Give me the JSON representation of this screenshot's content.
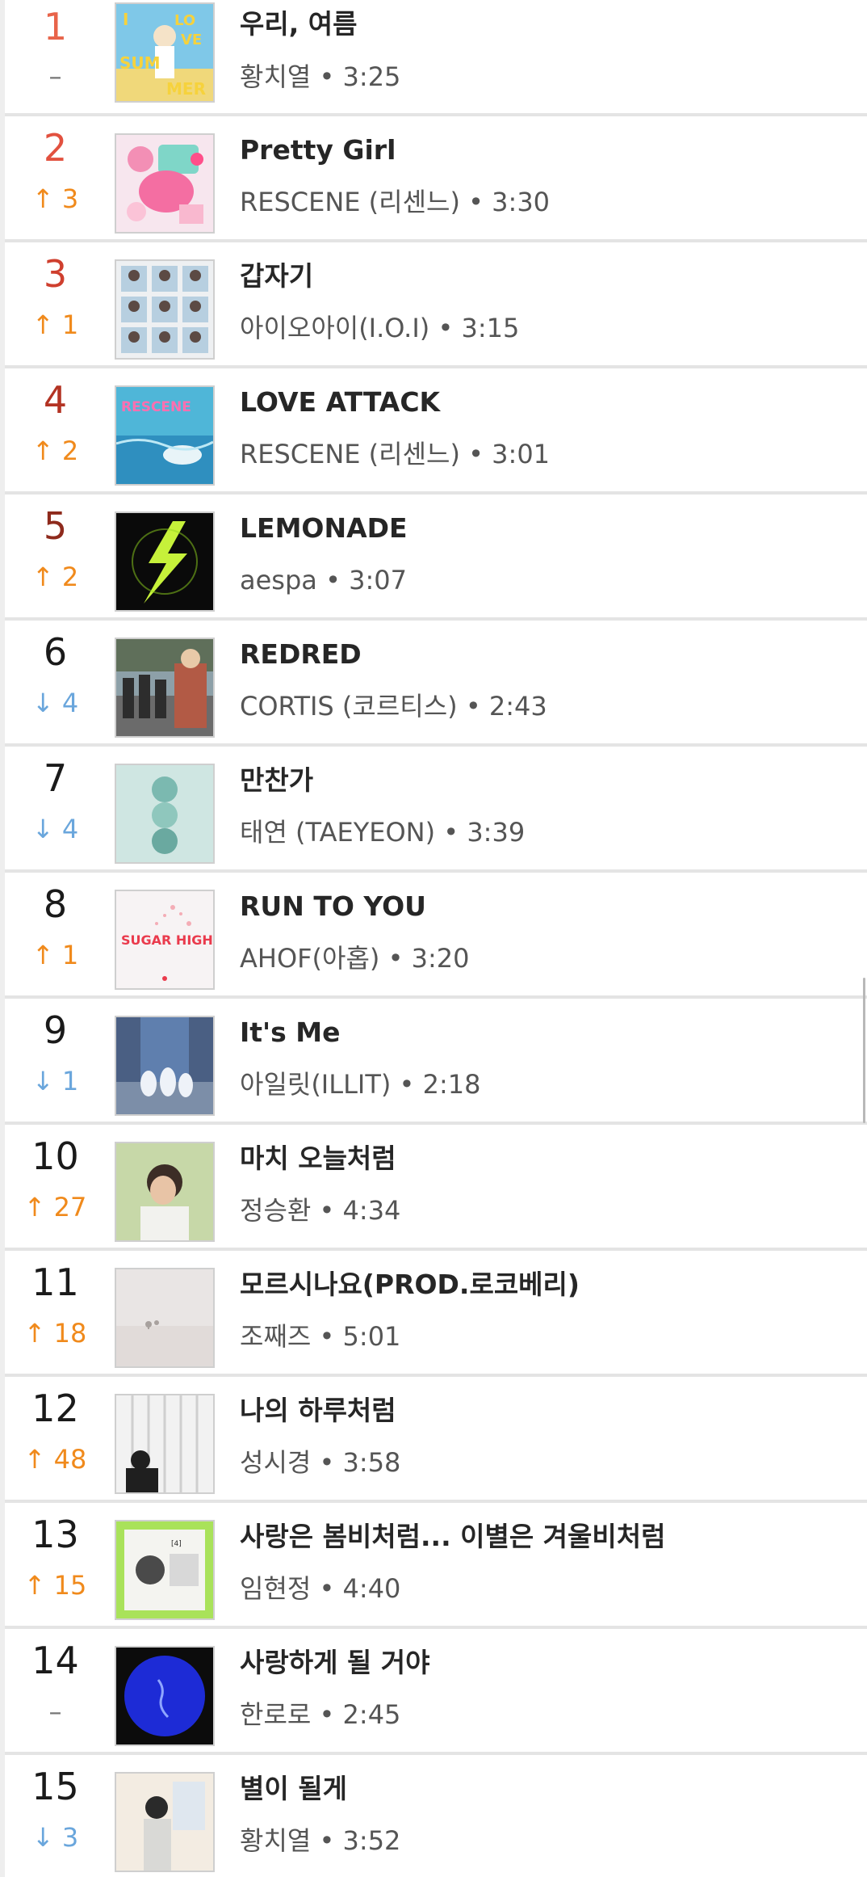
{
  "chart": {
    "items": [
      {
        "rank": "1",
        "change": "–",
        "change_dir": "same",
        "title": "우리, 여름",
        "artist": "황치열",
        "sep": "•",
        "duration": "3:25",
        "cover_icon": "album-cover-i-love-summer",
        "cover_text": "I LOVE SUM MER"
      },
      {
        "rank": "2",
        "change": "↑ 3",
        "change_dir": "up",
        "title": "Pretty Girl",
        "artist": "RESCENE (리센느)",
        "sep": "•",
        "duration": "3:30",
        "cover_icon": "album-cover-pink-collage"
      },
      {
        "rank": "3",
        "change": "↑ 1",
        "change_dir": "up",
        "title": "갑자기",
        "artist": "아이오아이(I.O.I)",
        "sep": "•",
        "duration": "3:15",
        "cover_icon": "album-cover-group-grid"
      },
      {
        "rank": "4",
        "change": "↑ 2",
        "change_dir": "up",
        "title": "LOVE ATTACK",
        "artist": "RESCENE (리센느)",
        "sep": "•",
        "duration": "3:01",
        "cover_icon": "album-cover-blue-water"
      },
      {
        "rank": "5",
        "change": "↑ 2",
        "change_dir": "up",
        "title": "LEMONADE",
        "artist": "aespa",
        "sep": "•",
        "duration": "3:07",
        "cover_icon": "album-cover-green-lightning"
      },
      {
        "rank": "6",
        "change": "↓ 4",
        "change_dir": "down",
        "title": "REDRED",
        "artist": "CORTIS (코르티스)",
        "sep": "•",
        "duration": "2:43",
        "cover_icon": "album-cover-group-street"
      },
      {
        "rank": "7",
        "change": "↓ 4",
        "change_dir": "down",
        "title": "만찬가",
        "artist": "태연 (TAEYEON)",
        "sep": "•",
        "duration": "3:39",
        "cover_icon": "album-cover-mint-circles"
      },
      {
        "rank": "8",
        "change": "↑ 1",
        "change_dir": "up",
        "title": "RUN TO YOU",
        "artist": "AHOF(아홉)",
        "sep": "•",
        "duration": "3:20",
        "cover_icon": "album-cover-sugar-high",
        "cover_text": "SUGAR HIGH"
      },
      {
        "rank": "9",
        "change": "↓ 1",
        "change_dir": "down",
        "title": "It's Me",
        "artist": "아일릿(ILLIT)",
        "sep": "•",
        "duration": "2:18",
        "cover_icon": "album-cover-street-ghosts"
      },
      {
        "rank": "10",
        "change": "↑ 27",
        "change_dir": "up",
        "title": "마치 오늘처럼",
        "artist": "정승환",
        "sep": "•",
        "duration": "4:34",
        "cover_icon": "album-cover-portrait-green"
      },
      {
        "rank": "11",
        "change": "↑ 18",
        "change_dir": "up",
        "title": "모르시나요(PROD.로코베리)",
        "artist": "조째즈",
        "sep": "•",
        "duration": "5:01",
        "cover_icon": "album-cover-misty-field"
      },
      {
        "rank": "12",
        "change": "↑ 48",
        "change_dir": "up",
        "title": "나의 하루처럼",
        "artist": "성시경",
        "sep": "•",
        "duration": "3:58",
        "cover_icon": "album-cover-curtain-room"
      },
      {
        "rank": "13",
        "change": "↑ 15",
        "change_dir": "up",
        "title": "사랑은 봄비처럼... 이별은 겨울비처럼",
        "artist": "임현정",
        "sep": "•",
        "duration": "4:40",
        "cover_icon": "album-cover-lime-frame"
      },
      {
        "rank": "14",
        "change": "–",
        "change_dir": "same",
        "title": "사랑하게 될 거야",
        "artist": "한로로",
        "sep": "•",
        "duration": "2:45",
        "cover_icon": "album-cover-blue-circle"
      },
      {
        "rank": "15",
        "change": "↓ 3",
        "change_dir": "down",
        "title": "별이 될게",
        "artist": "황치열",
        "sep": "•",
        "duration": "3:52",
        "cover_icon": "album-cover-piano-room"
      }
    ]
  },
  "colors": {
    "rank_top": [
      "#e8644a",
      "#e2513f",
      "#cf3f2e",
      "#b33323",
      "#8e2a1c"
    ],
    "rank_default": "#1a1a1a",
    "change_up": "#f08a1c",
    "change_down": "#6aa6dc",
    "change_same": "#777777",
    "title": "#262626",
    "meta": "#555555",
    "divider": "#e4e4e4"
  }
}
